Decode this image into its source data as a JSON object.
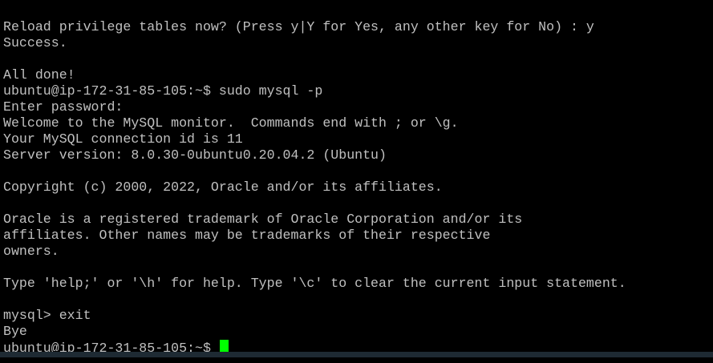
{
  "terminal": {
    "clipped_top_text": "'",
    "lines": [
      "Reload privilege tables now? (Press y|Y for Yes, any other key for No) : y",
      "Success.",
      "",
      "All done!",
      "ubuntu@ip-172-31-85-105:~$ sudo mysql -p",
      "Enter password:",
      "Welcome to the MySQL monitor.  Commands end with ; or \\g.",
      "Your MySQL connection id is 11",
      "Server version: 8.0.30-0ubuntu0.20.04.2 (Ubuntu)",
      "",
      "Copyright (c) 2000, 2022, Oracle and/or its affiliates.",
      "",
      "Oracle is a registered trademark of Oracle Corporation and/or its",
      "affiliates. Other names may be trademarks of their respective",
      "owners.",
      "",
      "Type 'help;' or '\\h' for help. Type '\\c' to clear the current input statement.",
      "",
      "mysql> exit",
      "Bye"
    ],
    "prompt": "ubuntu@ip-172-31-85-105:~$ ",
    "cursor_color": "#00ff00",
    "background_color": "#000000",
    "text_color": "#c0c0c0"
  }
}
